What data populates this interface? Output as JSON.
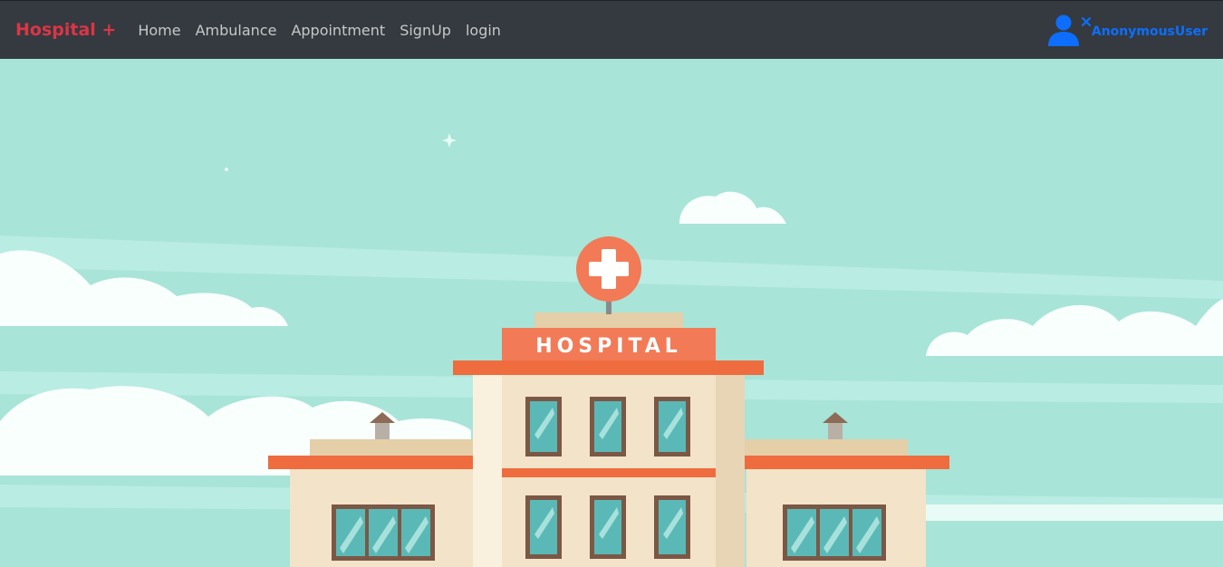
{
  "navbar": {
    "brand": "Hospital +",
    "links": [
      "Home",
      "Ambulance",
      "Appointment",
      "SignUp",
      "login"
    ],
    "user": {
      "icon": "user-icon",
      "close_icon": "close-icon",
      "name": "AnonymousUser"
    }
  },
  "hero": {
    "image": "hospital-illustration",
    "sign_text": "HOSPITAL",
    "colors": {
      "sky": "#a8e4d8",
      "accent": "#ee6c3e",
      "sign": "#f27a56",
      "building": "#f3e3c8",
      "window": "#5ab9b6"
    }
  },
  "colors": {
    "navbar_bg": "#343a40",
    "brand": "#dc3545",
    "user": "#0d6efd"
  }
}
